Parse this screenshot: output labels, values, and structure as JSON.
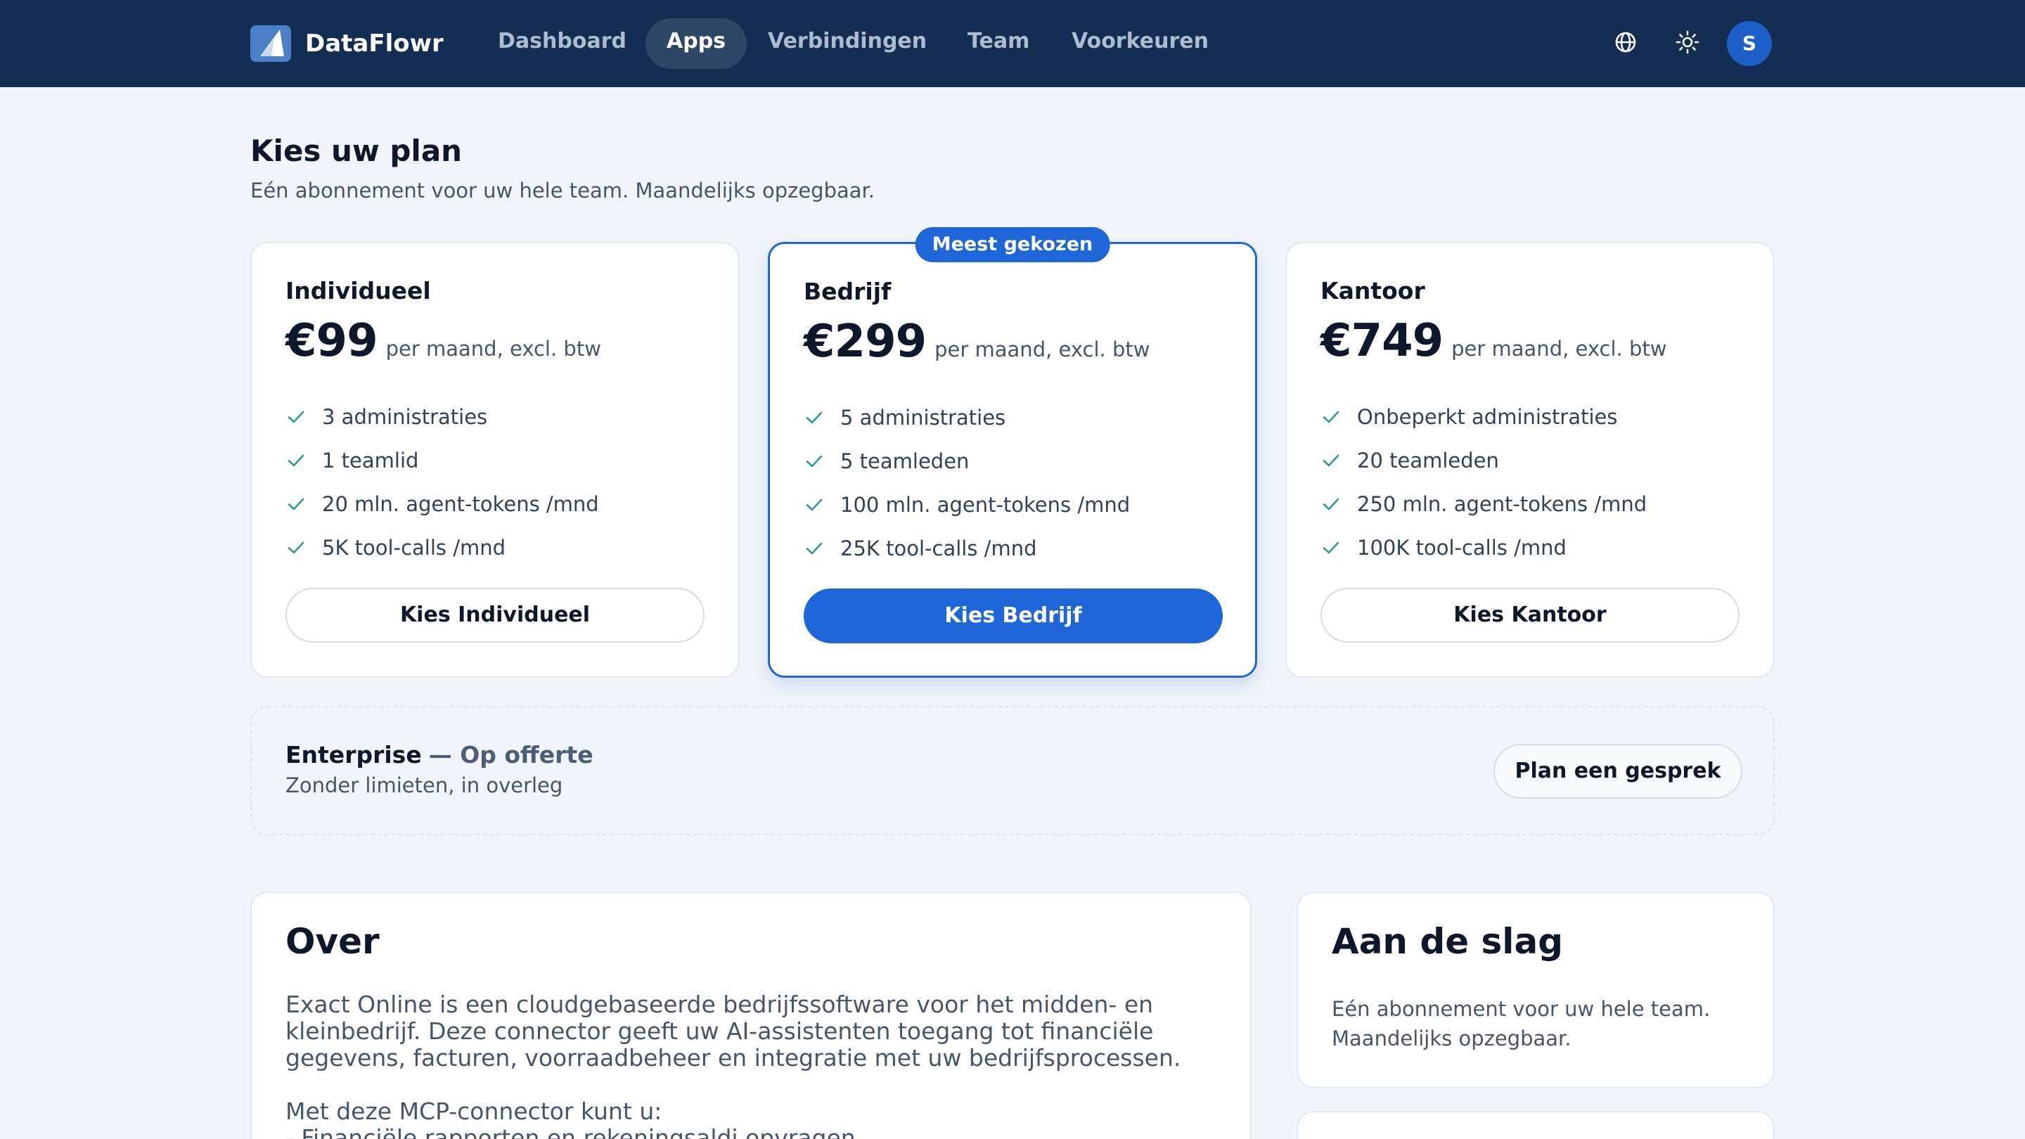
{
  "nav": {
    "brand": "DataFlowr",
    "items": [
      {
        "label": "Dashboard",
        "active": false
      },
      {
        "label": "Apps",
        "active": true
      },
      {
        "label": "Verbindingen",
        "active": false
      },
      {
        "label": "Team",
        "active": false
      },
      {
        "label": "Voorkeuren",
        "active": false
      }
    ],
    "icons": [
      "globe-icon",
      "sun-icon"
    ],
    "avatar_initial": "S"
  },
  "header": {
    "title": "Kies uw plan",
    "subtitle": "Eén abonnement voor uw hele team. Maandelijks opzegbaar."
  },
  "plans": [
    {
      "name": "Individueel",
      "price": "€99",
      "price_suffix": "per maand, excl. btw",
      "features": [
        "3 administraties",
        "1 teamlid",
        "20 mln. agent-tokens /mnd",
        "5K tool-calls /mnd"
      ],
      "button": "Kies Individueel"
    },
    {
      "name": "Bedrijf",
      "badge": "Meest gekozen",
      "price": "€299",
      "price_suffix": "per maand, excl. btw",
      "features": [
        "5 administraties",
        "5 teamleden",
        "100 mln. agent-tokens /mnd",
        "25K tool-calls /mnd"
      ],
      "button": "Kies Bedrijf"
    },
    {
      "name": "Kantoor",
      "price": "€749",
      "price_suffix": "per maand, excl. btw",
      "features": [
        "Onbeperkt administraties",
        "20 teamleden",
        "250 mln. agent-tokens /mnd",
        "100K tool-calls /mnd"
      ],
      "button": "Kies Kantoor"
    }
  ],
  "enterprise": {
    "name": "Enterprise",
    "price_note": "— Op offerte",
    "subtitle": "Zonder limieten, in overleg",
    "button": "Plan een gesprek"
  },
  "about": {
    "title": "Over",
    "body": "Exact Online is een cloudgebaseerde bedrijfssoftware voor het midden- en kleinbedrijf. Deze connector geeft uw AI-assistenten toegang tot financiële gegevens, facturen, voorraadbeheer en integratie met uw bedrijfsprocessen.",
    "list_intro": "Met deze MCP-connector kunt u:",
    "list": [
      "- Financiële rapporten en rekeningsaldi opvragen"
    ]
  },
  "getting_started": {
    "title": "Aan de slag",
    "body": "Eén abonnement voor uw hele team. Maandelijks opzegbaar."
  },
  "colors": {
    "nav_bg": "#132d53",
    "accent": "#1f66d8",
    "check": "#2a9d8f",
    "page_bg": "#f1f5f9"
  }
}
